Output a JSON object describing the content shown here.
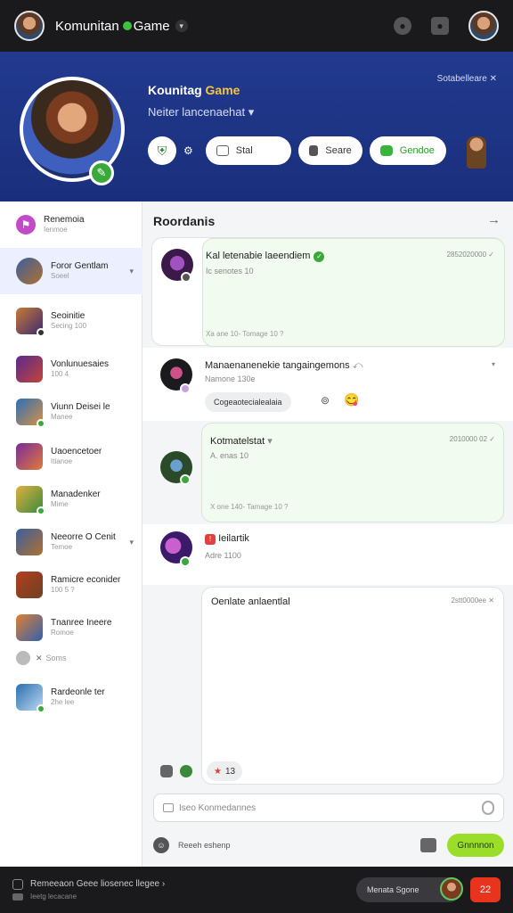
{
  "colors": {
    "accent_green": "#3aa83a",
    "hero_blue": "#223a8e",
    "send_green": "#9bde2a",
    "alert_red": "#e8341d"
  },
  "topbar": {
    "title_a": "Komunitan",
    "title_b": "Game",
    "dot_icon": "green-dot-icon",
    "right_icons": [
      "alien-icon",
      "user-icon"
    ]
  },
  "hero": {
    "title": "Kounitag",
    "title_accent": "Game",
    "subtitle": "Neiter lancenaehat",
    "link": "Sotabelleare",
    "actions": [
      {
        "label": "Stal"
      },
      {
        "label": "Seare"
      },
      {
        "label": "Gendoe"
      }
    ]
  },
  "sidebar": {
    "top": {
      "name": "Renemoia",
      "meta": "Ienmoe"
    },
    "items": [
      {
        "name": "Foror Gentlam",
        "meta": "Soeel"
      },
      {
        "name": "Seoinitie",
        "meta": "Secing 100"
      },
      {
        "name": "Vonlunuesaies",
        "meta": "100 4"
      },
      {
        "name": "Viunn Deisei le",
        "meta": "Manee"
      },
      {
        "name": "Uaoencetoer",
        "meta": "Itianoe"
      },
      {
        "name": "Manadenker",
        "meta": "Mime"
      },
      {
        "name": "Neeorre O Cenit",
        "meta": "Temoe"
      },
      {
        "name": "Ramicre econider",
        "meta": "100 5 ?"
      },
      {
        "name": "Tnanree Ineere",
        "meta": "Romoe"
      },
      {
        "name": "Soms",
        "meta": ""
      },
      {
        "name": "Rardeonle ter",
        "meta": "2he lee"
      }
    ]
  },
  "main": {
    "title": "Roordanis",
    "msgs": [
      {
        "title": "Kal letenabie laeendiem",
        "sub": "Ic senotes 10",
        "time": "2852020000",
        "foot": "Xa ane 10- Tomage 10 ?"
      },
      {
        "title": "Manaenanenekie tangaingemons",
        "sub": "Namone 130e",
        "tag": "Cogeaotecialealaia"
      },
      {
        "title": "Kotmatelstat",
        "sub": "A. enas 10",
        "time": "2010000 02",
        "foot": "X one 140- Tamage 10 ?"
      },
      {
        "title": "Ieilartik",
        "sub": "Adre 1100"
      },
      {
        "title": "Oenlate anlaentlal",
        "time": "2stt0000ee",
        "count": "13"
      }
    ],
    "compose_placeholder": "Iseo Konmedannes",
    "bottom_label": "Reeeh eshenp",
    "send_label": "Gnnnnon"
  },
  "footer": {
    "line1": "Remeeaon Geee liosenec llegee",
    "line2": "Ieetg lecacane",
    "pill": "Menata Sgone",
    "badge": "22"
  }
}
